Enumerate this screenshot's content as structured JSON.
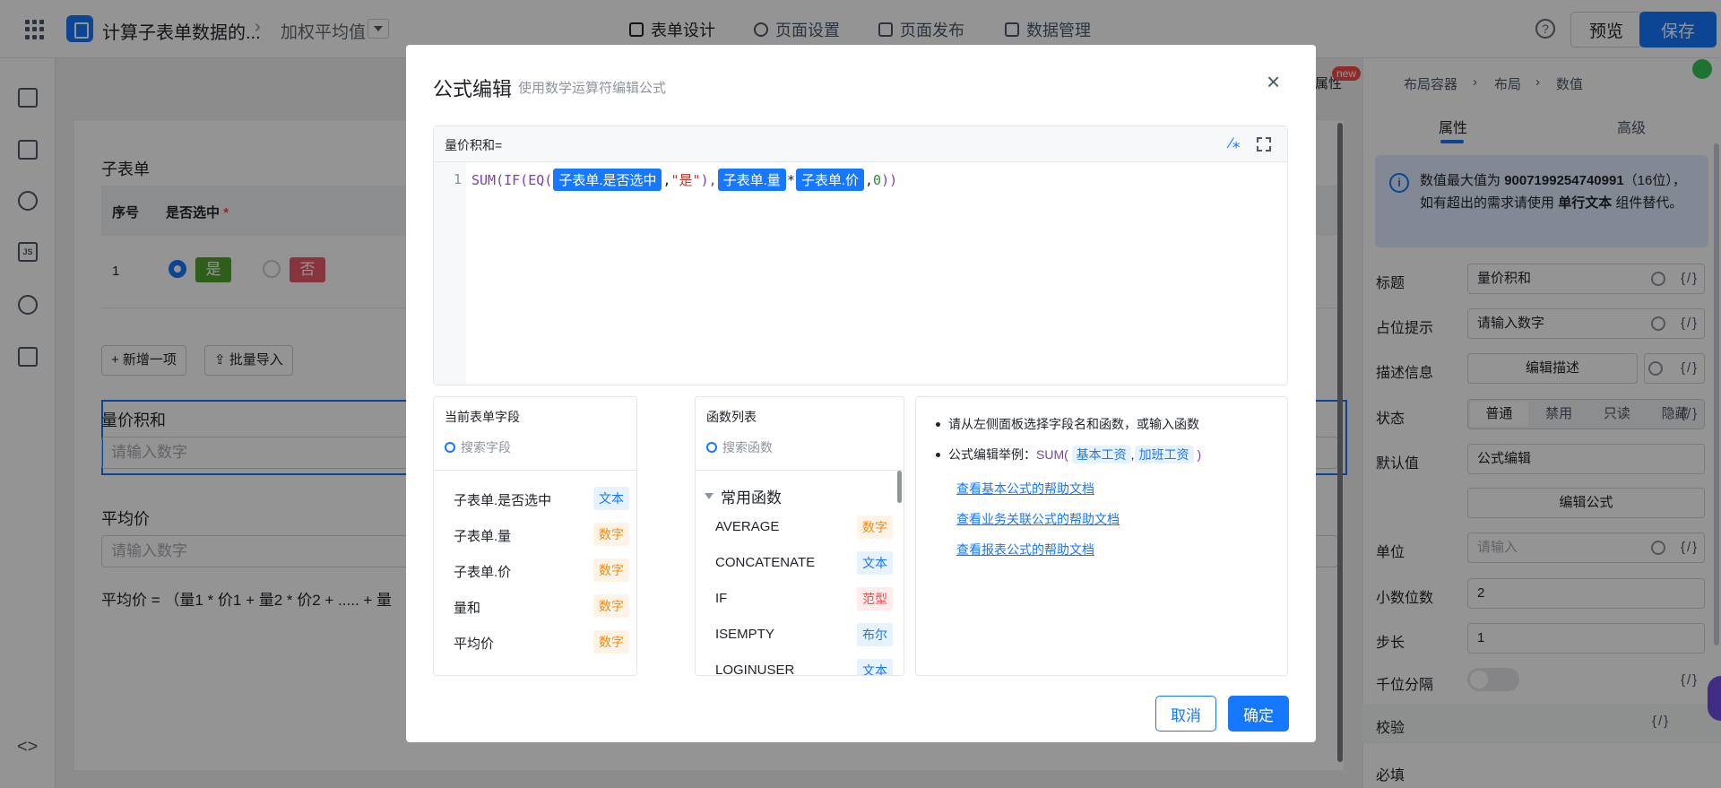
{
  "topbar": {
    "app_name": "计算子表单数据的...",
    "page_name": "加权平均值",
    "nav": [
      "表单设计",
      "页面设置",
      "页面发布",
      "数据管理"
    ],
    "help": "?",
    "preview": "预览",
    "save": "保存"
  },
  "canvas": {
    "subform_title": "子表单",
    "col_index": "序号",
    "col_selected": "是否选中",
    "required_mark": "*",
    "row_index": "1",
    "yes": "是",
    "no": "否",
    "add_item": "+ 新增一项",
    "batch_import": "⇪ 批量导入",
    "field1_label": "量价积和",
    "field1_placeholder": "请输入数字",
    "field2_label": "平均价",
    "field2_placeholder": "请输入数字",
    "formula_desc": "平均价 = （量1 * 价1 + 量2 * 价2 + ..... + 量"
  },
  "right_panel": {
    "prop_tag": "属性",
    "new_badge": "new",
    "crumbs": [
      "布局容器",
      "布局",
      "数值"
    ],
    "tabs": [
      "属性",
      "高级"
    ],
    "info_prefix": "数值最大值为",
    "info_max": "9007199254740991",
    "info_mid": "（16位），如有超出的需求请使用",
    "info_comp": "单行文本",
    "info_suffix": "组件替代。",
    "labels": {
      "title": "标题",
      "placeholder": "占位提示",
      "desc": "描述信息",
      "state": "状态",
      "default": "默认值",
      "unit": "单位",
      "decimals": "小数位数",
      "step": "步长",
      "thousands": "千位分隔",
      "validate": "校验",
      "required": "必填"
    },
    "title_value": "量价积和",
    "placeholder_value": "请输入数字",
    "desc_button": "编辑描述",
    "states": [
      "普通",
      "禁用",
      "只读",
      "隐藏"
    ],
    "default_value": "公式编辑",
    "edit_formula": "编辑公式",
    "unit_placeholder": "请输入",
    "decimals_value": "2",
    "step_value": "1",
    "fx": "{/}"
  },
  "modal": {
    "title": "公式编辑",
    "subtitle": "使用数学运算符编辑公式",
    "close": "×",
    "editor_label": "量价积和=",
    "line_no": "1",
    "code": {
      "fn1": "SUM(IF(EQ(",
      "pill1": "子表单.是否选中",
      "comma1": ",",
      "str": "\"是\"",
      "paren_comma": "),",
      "pill2": "子表单.量",
      "times": "*",
      "pill3": "子表单.价",
      "tail_comma": ",",
      "zero": "0",
      "close": "))"
    },
    "fields_title": "当前表单字段",
    "fields_search": "搜索字段",
    "fields": [
      {
        "name": "子表单.是否选中",
        "type": "文本"
      },
      {
        "name": "子表单.量",
        "type": "数字"
      },
      {
        "name": "子表单.价",
        "type": "数字"
      },
      {
        "name": "量和",
        "type": "数字"
      },
      {
        "name": "平均价",
        "type": "数字"
      }
    ],
    "functions_title": "函数列表",
    "functions_search": "搜索函数",
    "fn_group": "常用函数",
    "functions": [
      {
        "name": "AVERAGE",
        "type": "数字"
      },
      {
        "name": "CONCATENATE",
        "type": "文本"
      },
      {
        "name": "IF",
        "type": "范型"
      },
      {
        "name": "ISEMPTY",
        "type": "布尔"
      },
      {
        "name": "LOGINUSER",
        "type": "文本"
      }
    ],
    "help_tip1": "请从左侧面板选择字段名和函数，或输入函数",
    "help_tip2_prefix": "公式编辑举例：",
    "help_fn": "SUM(",
    "help_pill1": "基本工资",
    "help_comma": ",",
    "help_pill2": "加班工资",
    "help_close": ")",
    "links": [
      "查看基本公式的帮助文档",
      "查看业务关联公式的帮助文档",
      "查看报表公式的帮助文档"
    ],
    "cancel": "取消",
    "ok": "确定"
  }
}
